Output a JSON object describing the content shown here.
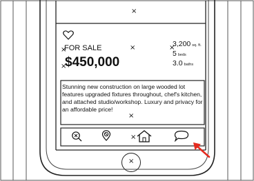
{
  "listing": {
    "status": "FOR SALE",
    "price": "$450,000",
    "sqft": "3,200",
    "sqft_unit": "sq. ft.",
    "beds": "5",
    "beds_unit": "beds",
    "baths": "3.0",
    "baths_unit": "baths",
    "description": "Stunning new construction on large wooded lot features upgraded fixtures throughout, chef's kitchen, and attached studio/workshop. Luxury and privacy for an affordable price!"
  },
  "placeholder_mark": "×",
  "icons": {
    "favorite": "heart-outline-icon",
    "search": "search-icon",
    "location": "location-icon",
    "home": "home-icon",
    "chat": "chat-bubble-icon",
    "home_button": "home-button"
  },
  "colors": {
    "pointer": "#e52b1f"
  }
}
